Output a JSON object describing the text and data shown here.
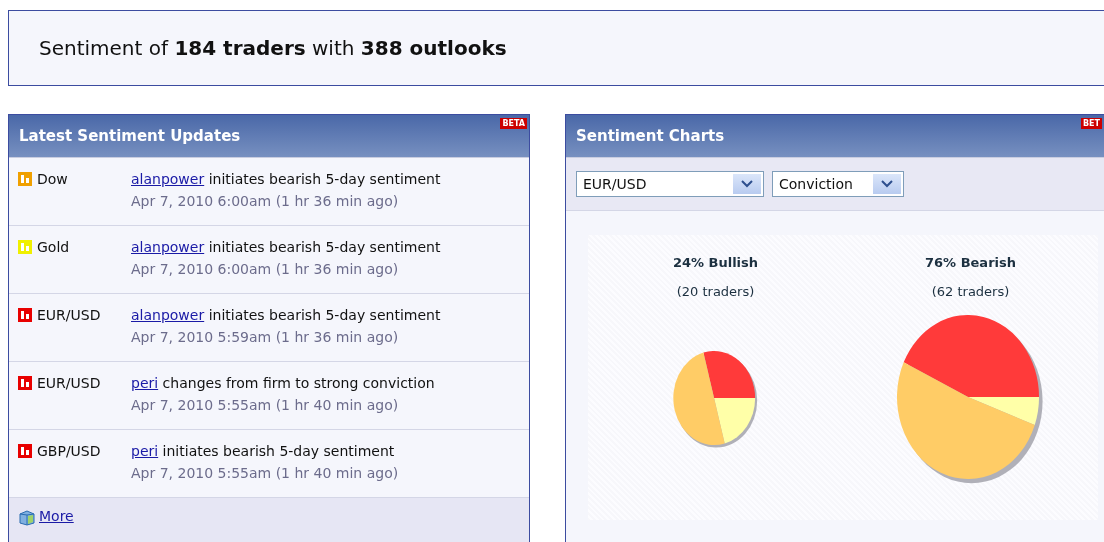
{
  "summary": "Sentiment of **184 traders** with **388 outlooks**",
  "updates_panel": {
    "title": "Latest Sentiment Updates",
    "badge": "BETA",
    "items": [
      {
        "symbol": "Dow",
        "color": "#f0a000",
        "user": "alanpower",
        "action": "initiates bearish 5-day sentiment",
        "time": "Apr 7, 2010 6:00am (1 hr 36 min ago)"
      },
      {
        "symbol": "Gold",
        "color": "#f0f000",
        "user": "alanpower",
        "action": "initiates bearish 5-day sentiment",
        "time": "Apr 7, 2010 6:00am (1 hr 36 min ago)"
      },
      {
        "symbol": "EUR/USD",
        "color": "#e80000",
        "user": "alanpower",
        "action": "initiates bearish 5-day sentiment",
        "time": "Apr 7, 2010 5:59am (1 hr 36 min ago)"
      },
      {
        "symbol": "EUR/USD",
        "color": "#e80000",
        "user": "peri",
        "action": "changes from firm to strong conviction",
        "time": "Apr 7, 2010 5:55am (1 hr 40 min ago)"
      },
      {
        "symbol": "GBP/USD",
        "color": "#e80000",
        "user": "peri",
        "action": "initiates bearish 5-day sentiment",
        "time": "Apr 7, 2010 5:55am (1 hr 40 min ago)"
      }
    ],
    "more_link": "More"
  },
  "charts_panel": {
    "title": "Sentiment Charts",
    "badge": "BET",
    "dropdowns": [
      {
        "kind": "instrument",
        "value": "EUR/USD"
      },
      {
        "kind": "measure",
        "value": "Conviction"
      }
    ],
    "groups": [
      {
        "kind": "small",
        "label": "24% Bullish",
        "count": "(20 traders)"
      },
      {
        "kind": "large",
        "label": "76% Bearish",
        "count": "(62 traders)"
      }
    ]
  }
}
